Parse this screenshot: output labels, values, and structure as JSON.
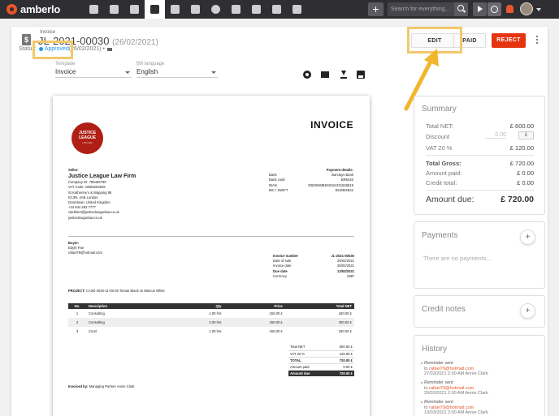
{
  "app": {
    "logo": "amberlo",
    "accent": "#e8562a"
  },
  "topnav": {
    "icons": [
      "dashboard-icon",
      "clients-icon",
      "matters-icon",
      "invoices-icon",
      "bank-icon",
      "chart-icon",
      "history-icon",
      "folder-icon",
      "document-icon",
      "edit-icon",
      "calendar-icon"
    ],
    "add_label": "+",
    "search_placeholder": "Search for everything..."
  },
  "header": {
    "doc_type": "Invoice",
    "number": "JL-2021-00030",
    "date": "(26/02/2021)",
    "status_label": "Status:",
    "status": "Approved",
    "status_date": "(26/02/2021)",
    "status_sep": "•",
    "status_color": "#2196f3"
  },
  "actions": {
    "edit": "EDIT",
    "paid": "PAID",
    "reject": "REJECT",
    "reject_color": "#e53510"
  },
  "settings": {
    "template_label": "Template",
    "template_value": "Invoice",
    "language_label": "Bill language",
    "language_value": "English"
  },
  "invoice": {
    "heading": "INVOICE",
    "logo_text": "JUSTICE LEAGUE",
    "logo_sub": "LAW FIRM",
    "seller_label": "Seller:",
    "seller_name": "Justice League Law Firm",
    "seller_lines": [
      "Company ID: 789456789",
      "VAT Code: GB00254849",
      "St Katherine's & Wapping 95",
      "EC3N, 4AB London",
      "Downtown, United Kingdom",
      "+44 844 482 7777",
      "clarkkent@justiceleaguelaw.co.uk",
      "justiceleaguelaw.co.uk"
    ],
    "payment_label": "Payment details:",
    "payment": [
      {
        "k": "Bank",
        "v": "Barclays Bank"
      },
      {
        "k": "Bank code",
        "v": "BR5442"
      },
      {
        "k": "IBAN",
        "v": "GB29NWBK60161331526819"
      },
      {
        "k": "BIC / SWIFT",
        "v": "BUKBGB22"
      }
    ],
    "buyer_label": "Buyer:",
    "buyer_name": "Edyth Fae",
    "buyer_email": "rafael79@hotmail.com",
    "meta": [
      {
        "k": "Invoice number",
        "v": "JL-2021-00030",
        "bold": true
      },
      {
        "k": "Date of sale",
        "v": "26/02/2021",
        "bold": false
      },
      {
        "k": "Invoice date",
        "v": "26/02/2021",
        "bold": false
      },
      {
        "k": "Due date",
        "v": "13/03/2021",
        "bold": true
      },
      {
        "k": "Currency",
        "v": "GBP",
        "bold": false
      }
    ],
    "project_label": "PROJECT:",
    "project_value": "CASE-2020-11-09-26 Tomas Black vs Marcus White",
    "items_headers": [
      "No.",
      "Description",
      "Qty",
      "Price",
      "Total NET"
    ],
    "items": [
      {
        "no": "1",
        "desc": "Consulting",
        "qty": "1.00 hrs",
        "price": "150.00 £",
        "total": "150.00 £"
      },
      {
        "no": "2",
        "desc": "Consulting",
        "qty": "2.00 hrs",
        "price": "150.00 £",
        "total": "300.00 £"
      },
      {
        "no": "3",
        "desc": "Court",
        "qty": "1.00 hrs",
        "price": "150.00 £",
        "total": "150.00 £"
      }
    ],
    "totals": [
      {
        "k": "Total NET",
        "v": "600.00 £",
        "style": ""
      },
      {
        "k": "VAT 20 %",
        "v": "120.00 £",
        "style": ""
      },
      {
        "k": "TOTAL",
        "v": "720.00 £",
        "style": "bold"
      },
      {
        "k": "Amount paid",
        "v": "0.00 £",
        "style": ""
      },
      {
        "k": "Amount due",
        "v": "720.00 £",
        "style": "due"
      }
    ],
    "invoiced_by_label": "Invoiced by:",
    "invoiced_by_value": "Managing Partner Annie Clark"
  },
  "summary": {
    "title": "Summary",
    "total_net_label": "Total NET:",
    "total_net": "£ 600.00",
    "discount_label": "Discount",
    "discount_value": "0.00",
    "discount_unit": "£",
    "vat_label": "VAT 20 %",
    "vat": "£ 120.00",
    "total_gross_label": "Total Gross:",
    "total_gross": "£ 720.00",
    "amount_paid_label": "Amount paid:",
    "amount_paid": "£ 0.00",
    "credit_total_label": "Credit total:",
    "credit_total": "£ 0.00",
    "amount_due_label": "Amount due:",
    "amount_due": "£ 720.00"
  },
  "payments": {
    "title": "Payments",
    "empty": "There are no payments..."
  },
  "credit_notes": {
    "title": "Credit notes"
  },
  "history": {
    "title": "History",
    "items": [
      {
        "title": "Reminder sent",
        "to": "to",
        "email": "rafael79@hotmail.com",
        "meta": "27/03/2021 2:00 AM Annie Clark"
      },
      {
        "title": "Reminder sent",
        "to": "to",
        "email": "rafael79@hotmail.com",
        "meta": "20/03/2021 2:00 AM Annie Clark"
      },
      {
        "title": "Reminder sent",
        "to": "to",
        "email": "rafael79@hotmail.com",
        "meta": "13/03/2021 2:00 AM Annie Clark"
      }
    ]
  }
}
